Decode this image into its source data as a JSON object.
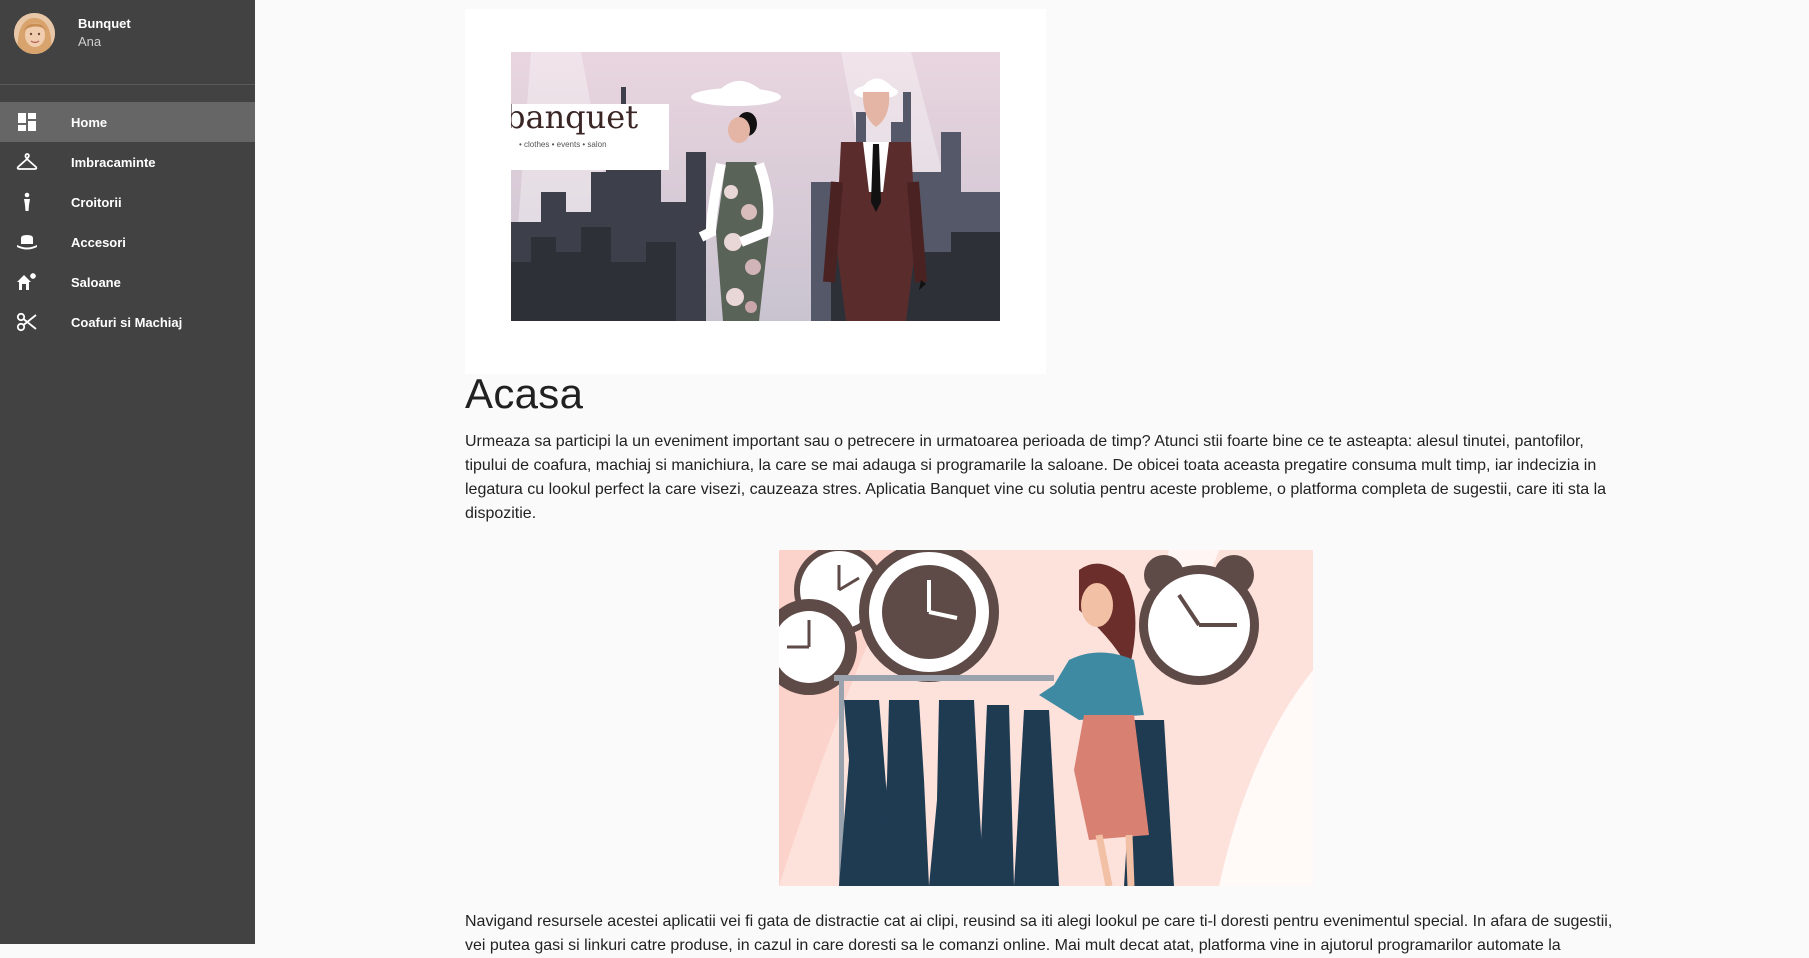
{
  "sidebar": {
    "profile": {
      "name": "Bunquet",
      "user": "Ana"
    },
    "items": [
      {
        "label": "Home",
        "icon": "dashboard-icon",
        "active": true
      },
      {
        "label": "Imbracaminte",
        "icon": "hanger-icon",
        "active": false
      },
      {
        "label": "Croitorii",
        "icon": "tailor-person-icon",
        "active": false
      },
      {
        "label": "Accesori",
        "icon": "hat-icon",
        "active": false
      },
      {
        "label": "Saloane",
        "icon": "salon-home-icon",
        "active": false
      },
      {
        "label": "Coafuri si Machiaj",
        "icon": "scissors-icon",
        "active": false
      }
    ]
  },
  "main": {
    "banner": {
      "brand": "banquet",
      "tagline": "• clothes   • events   • salon"
    },
    "title": "Acasa",
    "paragraph1": "Urmeaza sa participi la un eveniment important sau o petrecere in urmatoarea perioada de timp? Atunci stii foarte bine ce te asteapta: alesul tinutei, pantofilor, tipului de coafura, machiaj si manichiura, la care se mai adauga si programarile la saloane. De obicei toata aceasta pregatire consuma mult timp, iar indecizia in legatura cu lookul perfect la care visezi, cauzeaza stres. Aplicatia Banquet vine cu solutia pentru aceste probleme, o platforma completa de sugestii, care iti sta la dispozitie.",
    "paragraph2": "Navigand resursele acestei aplicatii vei fi gata de distractie cat ai clipi, reusind sa iti alegi lookul pe care ti-l doresti pentru evenimentul special. In afara de sugestii, vei putea gasi si linkuri catre produse, in cazul in care doresti sa le comanzi online. Mai mult decat atat, platforma vine in ajutorul programarilor automate la"
  },
  "colors": {
    "sidebar_bg": "#424242",
    "sidebar_active": "#666666",
    "page_bg": "#fafafa",
    "text": "#222222"
  }
}
